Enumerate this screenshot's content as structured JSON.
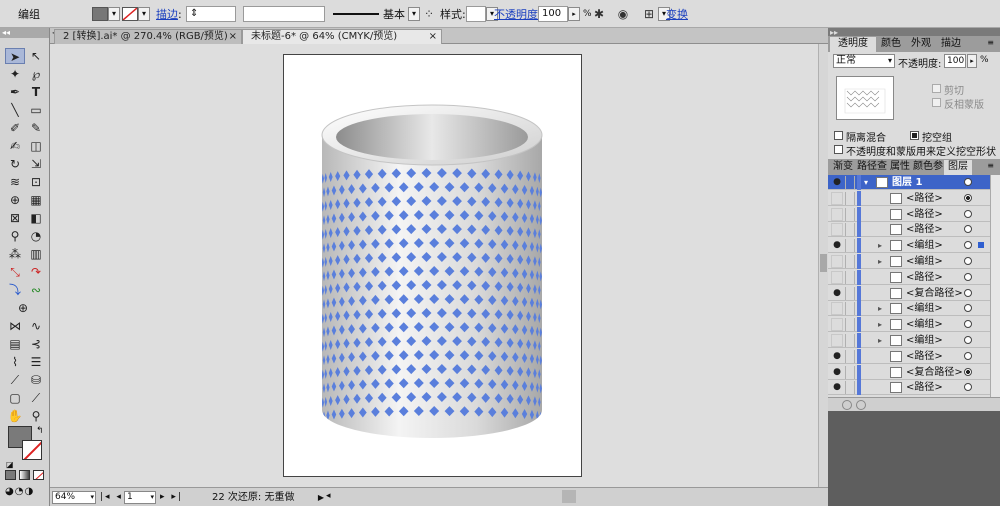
{
  "control_bar": {
    "selection_label": "编组",
    "stroke_link": "描边",
    "stroke_profile": "基本",
    "style_label": "样式:",
    "opacity_link": "不透明度",
    "opacity_value": "100",
    "opacity_unit": "%",
    "transform_link": "变换"
  },
  "doc_tabs": [
    {
      "label": "2 [转换].ai* @ 270.4% (RGB/预览)"
    },
    {
      "label": "未标题-6* @ 64% (CMYK/预览)"
    }
  ],
  "status_bar": {
    "zoom": "64%",
    "page": "1",
    "undo_status": "22 次还原: 无重做"
  },
  "transparency_panel": {
    "tabs": [
      "透明度",
      "颜色",
      "外观",
      "描边"
    ],
    "blend_mode": "正常",
    "opacity_label": "不透明度:",
    "opacity_value": "100",
    "opacity_unit": "%",
    "clip_label": "剪切",
    "invert_mask_label": "反相蒙版",
    "isolate_blend_label": "隔离混合",
    "knockout_group_label": "挖空组",
    "opacity_mask_label": "不透明度和蒙版用来定义挖空形状"
  },
  "layers_panel": {
    "tabs": [
      "渐变",
      "路径查",
      "属性",
      "颜色参",
      "图层"
    ],
    "rows": [
      {
        "name": "图层 1",
        "visible": true,
        "selected": true
      },
      {
        "name": "<路径>",
        "visible": false
      },
      {
        "name": "<路径>",
        "visible": false
      },
      {
        "name": "<路径>",
        "visible": false
      },
      {
        "name": "<编组>",
        "visible": true
      },
      {
        "name": "<编组>",
        "visible": false
      },
      {
        "name": "<路径>",
        "visible": false
      },
      {
        "name": "<复合路径>",
        "visible": true
      },
      {
        "name": "<编组>",
        "visible": false
      },
      {
        "name": "<编组>",
        "visible": false
      },
      {
        "name": "<编组>",
        "visible": false
      },
      {
        "name": "<路径>",
        "visible": true
      },
      {
        "name": "<复合路径>",
        "visible": true
      },
      {
        "name": "<路径>",
        "visible": true
      }
    ]
  },
  "colors": {
    "pattern_blue": "#5a7fdc",
    "selection_blue": "#2f5fd0",
    "panel_bg": "#dcdcdc"
  }
}
